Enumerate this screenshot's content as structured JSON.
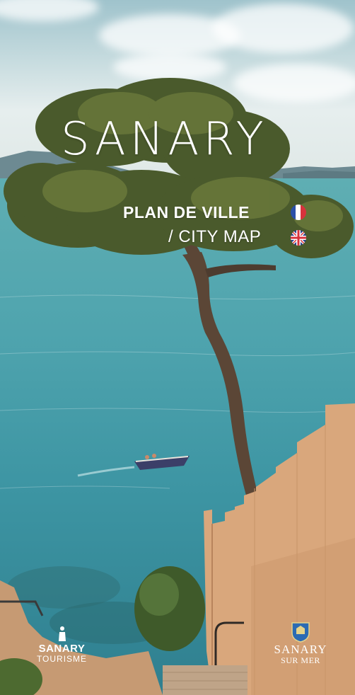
{
  "cover": {
    "title": "SANARY",
    "subtitle_fr": "PLAN DE VILLE",
    "subtitle_en": "/ CITY MAP"
  },
  "logos": {
    "left_line1": "SANARY",
    "left_line2": "TOURISME",
    "right_line1": "SANARY",
    "right_line2": "SUR MER"
  },
  "flags": {
    "fr": "france-flag-icon",
    "en": "uk-flag-icon"
  },
  "colors": {
    "sea": "#4fa4ae",
    "sky": "#c9dde0",
    "wall": "#d9a77c",
    "text": "#ffffff",
    "crest_blue": "#2c6bb3"
  }
}
